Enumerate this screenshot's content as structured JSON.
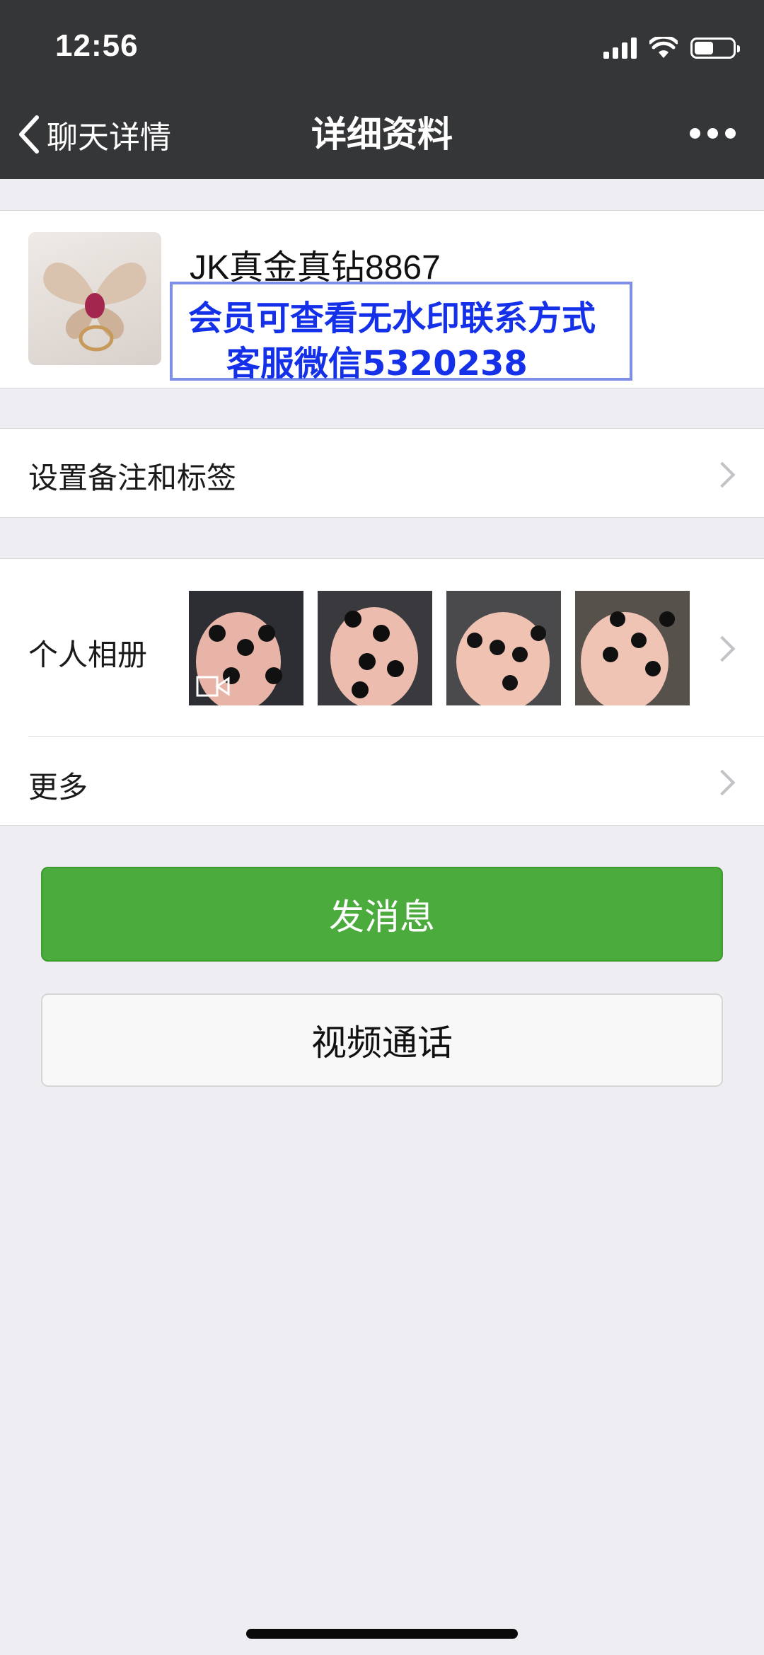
{
  "status_bar": {
    "time": "12:56",
    "battery_level": 0.5
  },
  "nav": {
    "back_label": "聊天详情",
    "title": "详细资料",
    "more_icon": "more-dots-icon"
  },
  "profile": {
    "name": "JK真金真钻8867",
    "avatar_icon": "butterfly-ring-avatar",
    "watermark_line1": "会员可查看无水印联系方式",
    "watermark_line2": "客服微信5320238"
  },
  "rows": {
    "remark_label": "设置备注和标签",
    "album_label": "个人相册",
    "more_label": "更多"
  },
  "album": {
    "thumbnails": [
      "necklace-photo-video",
      "necklace-photo",
      "necklace-photo",
      "necklace-photo"
    ],
    "first_is_video": true
  },
  "buttons": {
    "send_message": "发消息",
    "video_call": "视频通话"
  },
  "colors": {
    "nav_bg": "#353638",
    "primary_green": "#4cab3d",
    "watermark_blue": "#1430e8",
    "page_bg": "#ededf2"
  }
}
